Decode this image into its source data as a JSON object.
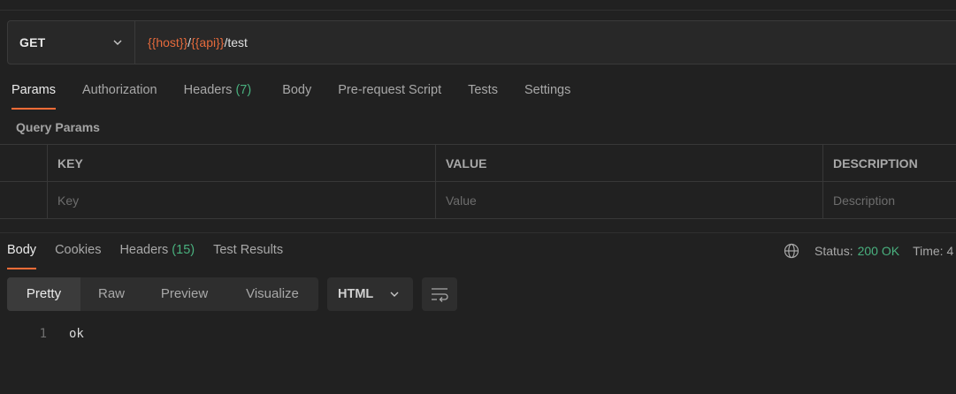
{
  "request": {
    "method": "GET",
    "url_parts": [
      {
        "text": "{{host}}",
        "type": "var"
      },
      {
        "text": "/",
        "type": "plain"
      },
      {
        "text": "{{api}}",
        "type": "var"
      },
      {
        "text": "/test",
        "type": "plain"
      }
    ]
  },
  "request_tabs": [
    {
      "label": "Params",
      "active": true
    },
    {
      "label": "Authorization"
    },
    {
      "label": "Headers",
      "count": "(7)"
    },
    {
      "label": "Body"
    },
    {
      "label": "Pre-request Script"
    },
    {
      "label": "Tests"
    },
    {
      "label": "Settings"
    }
  ],
  "query_params": {
    "title": "Query Params",
    "columns": [
      "KEY",
      "VALUE",
      "DESCRIPTION"
    ],
    "placeholders": {
      "key": "Key",
      "value": "Value",
      "description": "Description"
    }
  },
  "response_tabs": [
    {
      "label": "Body",
      "active": true
    },
    {
      "label": "Cookies"
    },
    {
      "label": "Headers",
      "count": "(15)"
    },
    {
      "label": "Test Results"
    }
  ],
  "status": {
    "status_label": "Status:",
    "status_value": "200 OK",
    "time_label": "Time: 4"
  },
  "view_modes": [
    {
      "label": "Pretty",
      "active": true
    },
    {
      "label": "Raw"
    },
    {
      "label": "Preview"
    },
    {
      "label": "Visualize"
    }
  ],
  "format": "HTML",
  "response_body": {
    "line_number": "1",
    "text": "ok"
  },
  "colors": {
    "accent": "#ff6c37",
    "variable": "#e56a3c",
    "success": "#49b07e",
    "background": "#212121"
  }
}
